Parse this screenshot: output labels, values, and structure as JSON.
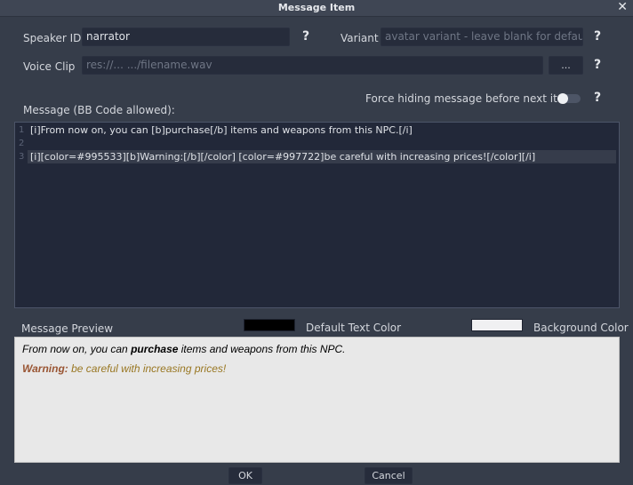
{
  "window": {
    "title": "Message Item",
    "close_glyph": "✕"
  },
  "form": {
    "speaker_id_label": "Speaker ID",
    "speaker_id_value": "narrator",
    "variant_label": "Variant",
    "variant_placeholder": "avatar variant - leave blank for default",
    "voice_clip_label": "Voice Clip",
    "voice_clip_placeholder": "res://... .../filename.wav",
    "browse_label": "...",
    "help_glyph": "?",
    "force_hide_label": "Force hiding message before next item",
    "force_hide_enabled": false,
    "message_label": "Message (BB Code allowed):"
  },
  "editor": {
    "lines": [
      {
        "number": "1",
        "text": "[i]From now on, you can [b]purchase[/b] items and weapons from this NPC.[/i]"
      },
      {
        "number": "2",
        "text": ""
      },
      {
        "number": "3",
        "text": "[i][color=#995533][b]Warning:[/b][/color] [color=#997722]be careful with increasing prices![/color][/i]"
      }
    ],
    "current_line": 3
  },
  "preview": {
    "label": "Message Preview",
    "default_text_color_label": "Default Text Color",
    "default_text_color": "#000000",
    "background_color_label": "Background Color",
    "background_color": "#f0f0f2",
    "line1": {
      "before": "From now on, you can ",
      "bold": "purchase",
      "after": " items and weapons from this NPC."
    },
    "line2": {
      "warning": "Warning:",
      "warning_color": "#995533",
      "rest": " be careful with increasing prices!",
      "rest_color": "#997722"
    }
  },
  "buttons": {
    "ok": "OK",
    "cancel": "Cancel"
  }
}
